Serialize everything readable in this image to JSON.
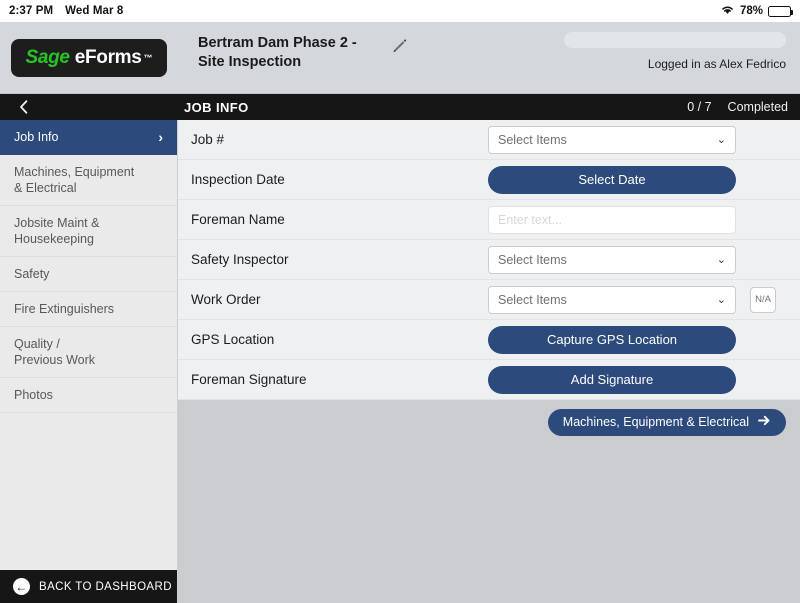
{
  "status_bar": {
    "time": "2:37 PM",
    "date": "Wed Mar 8",
    "wifi_icon": "wifi-icon",
    "battery_percent": "78%",
    "battery_icon": "battery-icon"
  },
  "header": {
    "logo_sage": "Sage",
    "logo_forms": "eForms",
    "logo_tm": "™",
    "form_title": "Bertram Dam Phase 2 - Site Inspection",
    "edit_icon": "pencil-icon",
    "search_value": "",
    "search_placeholder": "",
    "logged_in_as": "Logged in as Alex Fedrico"
  },
  "section_bar": {
    "back_icon": "chevron-left-icon",
    "title": "JOB INFO",
    "progress": "0 / 7",
    "progress_label": "Completed"
  },
  "sidebar": {
    "items": [
      {
        "label": "Job Info",
        "active": true,
        "chevron": "›"
      },
      {
        "label": "Machines, Equipment\n& Electrical",
        "active": false
      },
      {
        "label": "Jobsite Maint &\nHousekeeping",
        "active": false
      },
      {
        "label": "Safety",
        "active": false
      },
      {
        "label": "Fire Extinguishers",
        "active": false
      },
      {
        "label": "Quality /\nPrevious Work",
        "active": false
      },
      {
        "label": "Photos",
        "active": false
      }
    ],
    "back_to_dashboard": "BACK TO DASHBOARD",
    "back_to_dashboard_icon": "circle-arrow-left-icon"
  },
  "form": {
    "rows": [
      {
        "label": "Job #",
        "control": "select",
        "value": "Select Items",
        "icon": "chevron-down-icon"
      },
      {
        "label": "Inspection Date",
        "control": "button",
        "value": "Select Date"
      },
      {
        "label": "Foreman Name",
        "control": "text",
        "value": "",
        "placeholder": "Enter text..."
      },
      {
        "label": "Safety Inspector",
        "control": "select",
        "value": "Select Items",
        "icon": "chevron-down-icon"
      },
      {
        "label": "Work Order",
        "control": "select",
        "value": "Select Items",
        "icon": "chevron-down-icon",
        "na_label": "N/A"
      },
      {
        "label": "GPS Location",
        "control": "button",
        "value": "Capture GPS Location"
      },
      {
        "label": "Foreman Signature",
        "control": "button",
        "value": "Add Signature"
      }
    ],
    "next_button": "Machines, Equipment & Electrical",
    "next_icon": "arrow-right-icon"
  },
  "colors": {
    "accent_blue": "#2c4a7c",
    "logo_green": "#22c722",
    "bar_black": "#161616",
    "header_gray": "#d4d8dc",
    "content_gray": "#cbcccf"
  }
}
